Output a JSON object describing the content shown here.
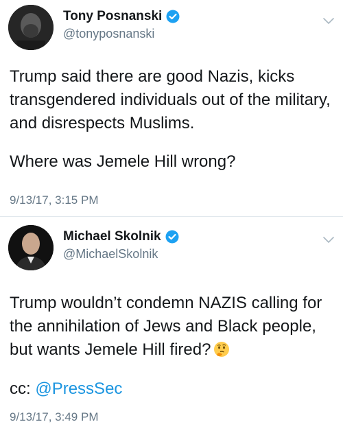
{
  "tweets": [
    {
      "name": "Tony Posnanski",
      "handle": "@tonyposnanski",
      "paragraph1": "Trump said there are good Nazis, kicks transgendered individuals out of the military, and disrespects Muslims.",
      "paragraph2": "Where was Jemele Hill wrong?",
      "timestamp": "9/13/17, 3:15 PM"
    },
    {
      "name": "Michael Skolnik",
      "handle": "@MichaelSkolnik",
      "paragraph1": "Trump wouldn’t condemn NAZIS calling for the annihilation of Jews and Black people, but wants Jemele Hill fired?",
      "paragraph2_prefix": "cc: ",
      "paragraph2_mention": "@PressSec",
      "timestamp": "9/13/17, 3:49 PM"
    }
  ],
  "colors": {
    "verified": "#1da1f2",
    "mention": "#1b95e0",
    "secondary_text": "#657786",
    "divider": "#e1e8ed"
  },
  "icons": {
    "verified": "verified-badge-icon",
    "chevron": "chevron-down-icon",
    "emoji": "thinking-face-emoji"
  }
}
